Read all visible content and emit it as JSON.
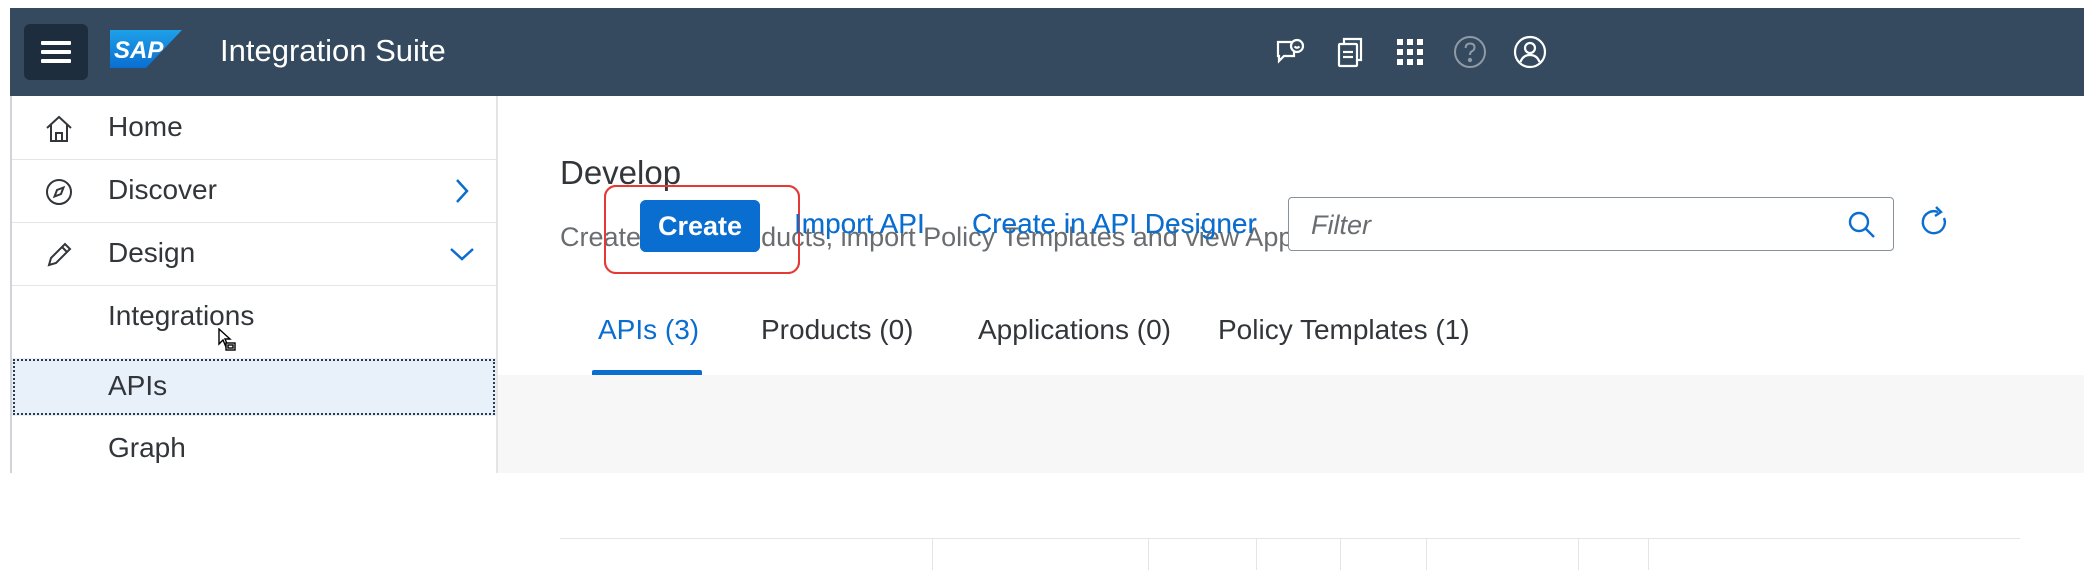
{
  "header": {
    "title": "Integration Suite",
    "logo_text": "SAP",
    "icons": [
      "menu-icon",
      "feedback-icon",
      "notifications-icon",
      "product-switch-icon",
      "help-icon",
      "user-icon"
    ]
  },
  "sidebar": {
    "items": [
      {
        "label": "Home",
        "icon": "home-icon"
      },
      {
        "label": "Discover",
        "icon": "compass-icon",
        "chevron": "chevron-right-icon"
      },
      {
        "label": "Design",
        "icon": "pencil-icon",
        "chevron": "chevron-down-icon"
      },
      {
        "label": "Integrations"
      },
      {
        "label": "APIs",
        "selected": true
      },
      {
        "label": "Graph"
      }
    ]
  },
  "main": {
    "title": "Develop",
    "description": "Create APIs, Products, import Policy Templates and view Applications here.",
    "tabs": [
      {
        "label": "APIs (3)",
        "active": true
      },
      {
        "label": "Products (0)"
      },
      {
        "label": "Applications (0)"
      },
      {
        "label": "Policy Templates (1)"
      }
    ],
    "toolbar": {
      "create_label": "Create",
      "import_label": "Import API",
      "designer_label": "Create in API Designer",
      "filter_placeholder": "Filter"
    }
  },
  "colors": {
    "shell": "#354a5f",
    "accent": "#0a6ed1",
    "highlight": "#e53935"
  }
}
